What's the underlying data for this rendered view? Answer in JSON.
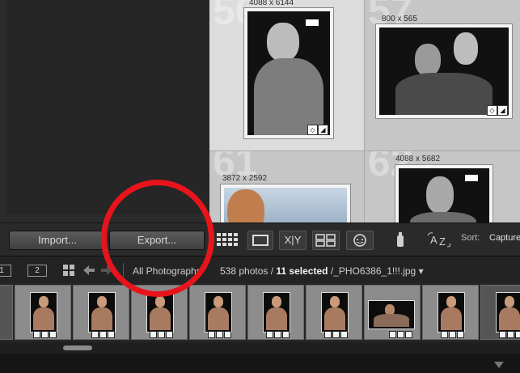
{
  "grid": {
    "cells": [
      {
        "number": "56",
        "dimensions": "4088 x 6144"
      },
      {
        "number": "57",
        "dimensions": "800 x 565"
      },
      {
        "number": "61",
        "dimensions": "3872 x 2592"
      },
      {
        "number": "62",
        "dimensions": "4088 x 5682"
      }
    ]
  },
  "toolbar": {
    "import_label": "Import...",
    "export_label": "Export...",
    "view_modes": [
      "grid-view-icon",
      "loupe-view-icon",
      "compare-view-icon",
      "survey-view-icon",
      "people-view-icon"
    ],
    "compare_label": "X|Y",
    "sort_label": "Sort:",
    "sort_value": "Capture Time"
  },
  "filmstrip_header": {
    "page_1": "1",
    "page_2": "2",
    "source": "All Photographs",
    "photo_count": "538 photos /",
    "selected": "11 selected",
    "filename": " /_PHO6386_1!!!.jpg",
    "dropdown_glyph": "▾"
  },
  "filmstrip": {
    "thumb_count": 10
  },
  "colors": {
    "annotation": "#e8141b",
    "panel": "#2b2b2b",
    "grid_bg": "#c9c9c9"
  }
}
